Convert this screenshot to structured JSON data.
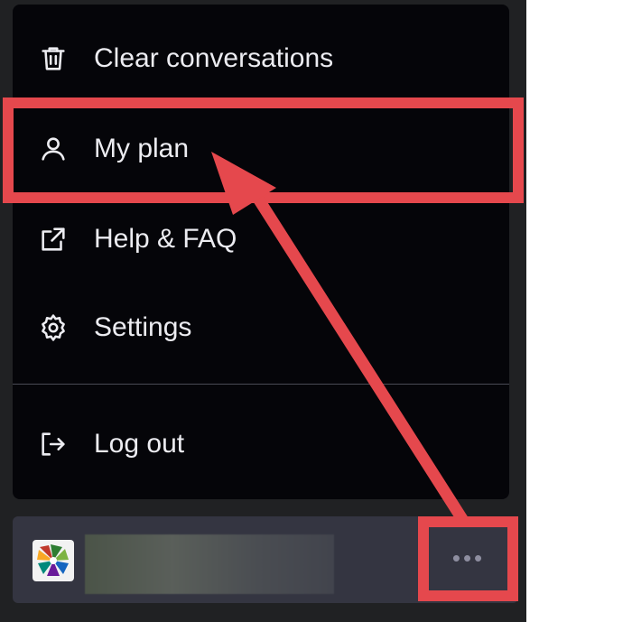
{
  "menu": {
    "items": [
      {
        "label": "Clear conversations",
        "icon": "trash-icon"
      },
      {
        "label": "My plan",
        "icon": "user-icon"
      },
      {
        "label": "Help & FAQ",
        "icon": "external-link-icon"
      },
      {
        "label": "Settings",
        "icon": "gear-icon"
      },
      {
        "label": "Log out",
        "icon": "logout-icon"
      }
    ]
  },
  "footer": {
    "more_label": "•••"
  },
  "colors": {
    "annotation": "#e5484d",
    "menu_bg": "#050509",
    "panel_bg": "#202123",
    "footer_bg": "#343541",
    "text": "#ececf1"
  }
}
